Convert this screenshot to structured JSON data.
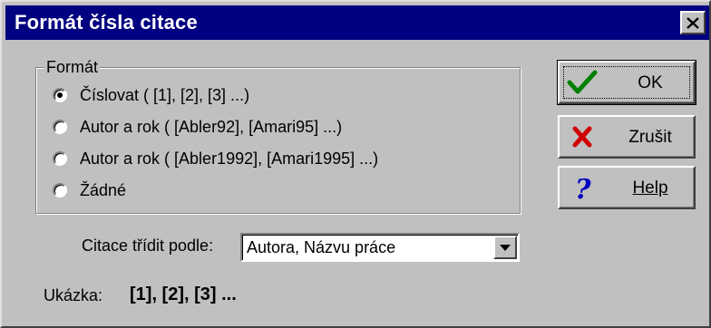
{
  "window": {
    "title": "Formát čísla citace",
    "close_icon": "close-icon"
  },
  "format_group": {
    "legend": "Formát",
    "options": [
      {
        "label": "Číslovat ( [1], [2], [3] ...)",
        "checked": true
      },
      {
        "label": "Autor a rok ( [Abler92], [Amari95] ...)",
        "checked": false
      },
      {
        "label": "Autor a rok ( [Abler1992], [Amari1995] ...)",
        "checked": false
      },
      {
        "label": "Žádné",
        "checked": false
      }
    ]
  },
  "buttons": {
    "ok": {
      "label": "OK",
      "icon": "checkmark-icon"
    },
    "cancel": {
      "label": "Zrušit",
      "icon": "red-x-icon"
    },
    "help": {
      "label": "Help",
      "icon": "question-mark-icon"
    }
  },
  "sort": {
    "label": "Citace třídit podle:",
    "value": "Autora, Názvu práce"
  },
  "preview": {
    "label": "Ukázka:",
    "value": "[1], [2], [3] ..."
  },
  "colors": {
    "titlebar": "#000080",
    "face": "#c0c0c0",
    "check_green": "#008000",
    "x_red": "#d00000",
    "help_blue": "#0000c0"
  }
}
